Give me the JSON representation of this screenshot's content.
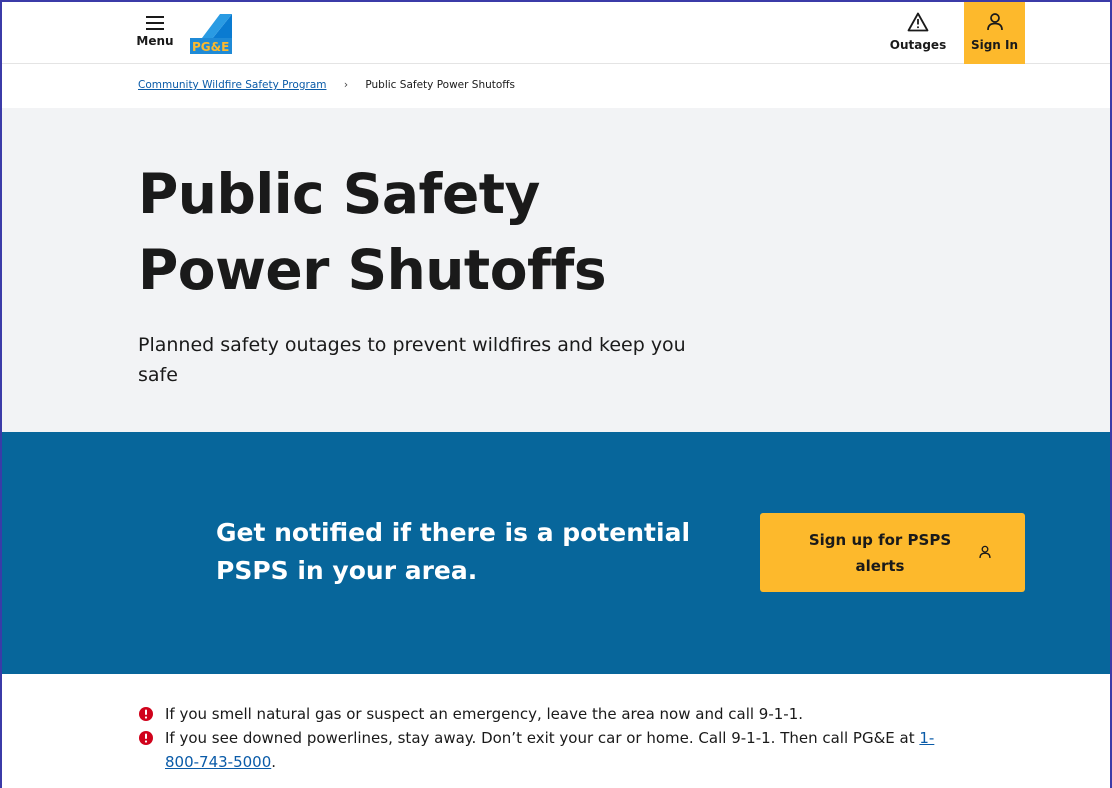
{
  "header": {
    "menu_label": "Menu",
    "logo_text": "PG&E",
    "outages_label": "Outages",
    "signin_label": "Sign In"
  },
  "breadcrumb": {
    "parent": "Community Wildfire Safety Program",
    "separator": "›",
    "current": "Public Safety Power Shutoffs"
  },
  "hero": {
    "title_line1": "Public Safety",
    "title_line2": "Power Shutoffs",
    "subtitle": "Planned safety outages to prevent wildfires and keep you safe"
  },
  "banner": {
    "message_line1": "Get notified if there is a potential",
    "message_line2": "PSPS in your area.",
    "cta_line1": "Sign up for PSPS",
    "cta_line2": "alerts"
  },
  "alerts": {
    "gas_text": "If you smell natural gas or suspect an emergency, leave the area now and call 9-1-1.",
    "powerline_text": "If you see downed powerlines, stay away. Don’t exit your car or home. Call 9-1-1. Then call PG&E at ",
    "phone_part1": "1-",
    "phone_part2": "800-743-5000",
    "phone_suffix": "."
  },
  "icons": {
    "menu": "hamburger-icon",
    "outages": "warning-triangle-icon",
    "signin": "user-icon",
    "cta": "user-icon",
    "alert": "exclamation-circle-icon"
  },
  "colors": {
    "accent_yellow": "#fdb92c",
    "banner_blue": "#07669b",
    "link_blue": "#0a5ba8",
    "alert_red": "#d0021b",
    "hero_bg": "#f2f3f5"
  }
}
